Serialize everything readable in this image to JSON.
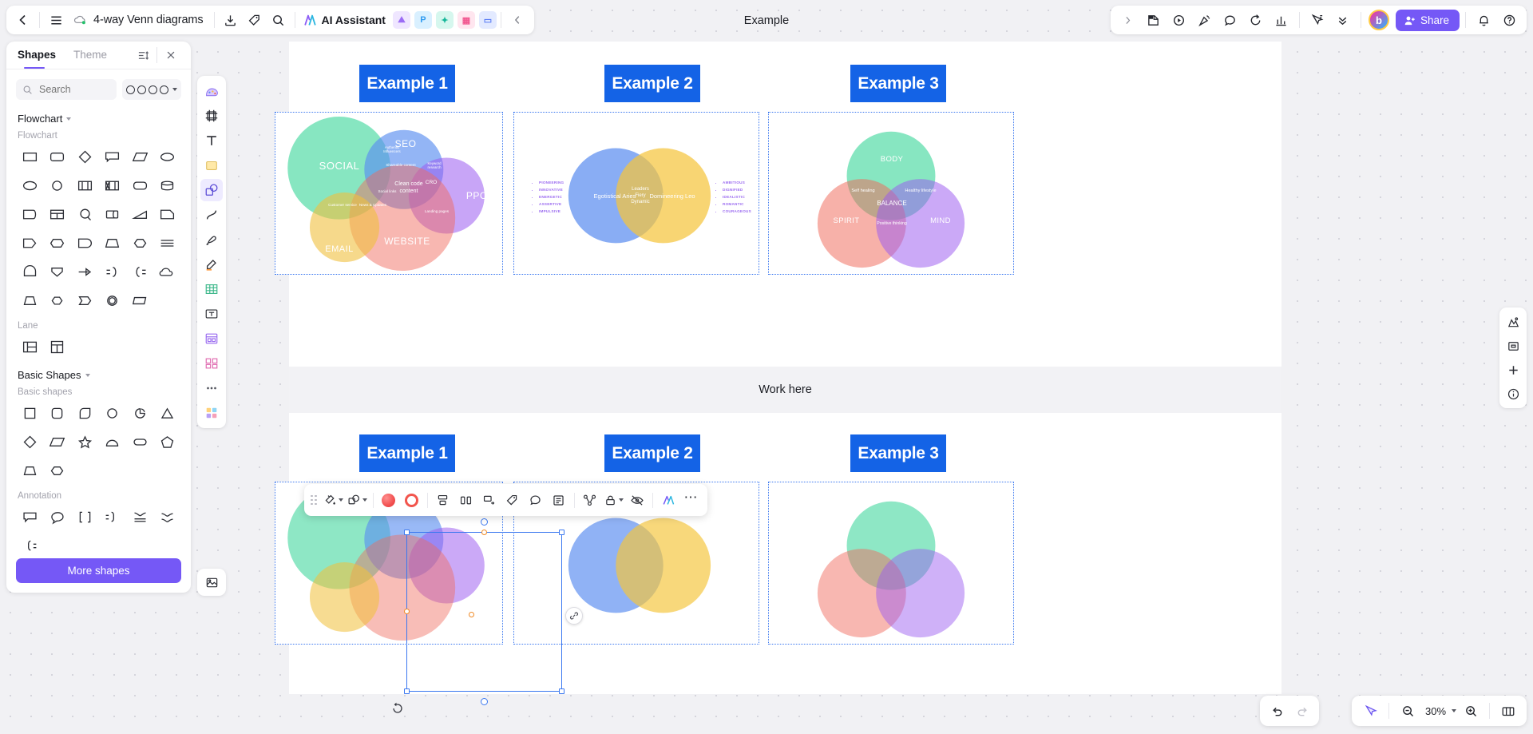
{
  "header": {
    "back_icon": "chevron-left-icon",
    "menu_icon": "hamburger-menu-icon",
    "cloud_icon": "cloud-sync-icon",
    "doc_title": "4-way Venn diagrams",
    "download_icon": "download-icon",
    "tag_icon": "tag-icon",
    "search_icon": "search-icon",
    "ai_assistant_label": "AI Assistant",
    "ai_icon": "ai-sparkle-icon",
    "apps": [
      {
        "name": "image-gen-app",
        "glyph": "⛰",
        "bg": "#efe6ff",
        "fg": "#9b6bf5"
      },
      {
        "name": "presentation-app",
        "glyph": "P",
        "bg": "#d9f0ff",
        "fg": "#2f9bf0"
      },
      {
        "name": "mindmap-app",
        "glyph": "✦",
        "bg": "#d6f7ee",
        "fg": "#16b79a"
      },
      {
        "name": "table-app",
        "glyph": "▦",
        "bg": "#ffe6ef",
        "fg": "#f2568f"
      },
      {
        "name": "comment-app",
        "glyph": "▭",
        "bg": "#e3eaff",
        "fg": "#5b7df5"
      }
    ],
    "collapse_icon": "chevron-left-icon",
    "center_title": "Example",
    "right_tools": [
      {
        "name": "expand-right-icon",
        "glyph": "chevron-right"
      },
      {
        "name": "sticky-note-icon",
        "glyph": "note"
      },
      {
        "name": "play-record-icon",
        "glyph": "play"
      },
      {
        "name": "celebrate-icon",
        "glyph": "party"
      },
      {
        "name": "comment-bubble-icon",
        "glyph": "bubble"
      },
      {
        "name": "timer-icon",
        "glyph": "timer"
      },
      {
        "name": "vote-chart-icon",
        "glyph": "chart"
      },
      {
        "name": "presenter-cursor-icon",
        "glyph": "cursor"
      },
      {
        "name": "chevron-double-down-icon",
        "glyph": "chevrons"
      }
    ],
    "avatar_initial": "b",
    "share_label": "Share",
    "share_color": "#7558f6",
    "share_icon": "person-add-icon",
    "bell_icon": "bell-icon",
    "help_icon": "question-circle-icon"
  },
  "shapes_panel": {
    "tabs": [
      {
        "label": "Shapes",
        "active": true
      },
      {
        "label": "Theme",
        "active": false
      }
    ],
    "list_icon": "sort-list-icon",
    "close_icon": "close-icon",
    "search_placeholder": "Search",
    "search_value": "",
    "shape_picker_icon": "circles-style-picker",
    "groups": [
      {
        "title": "Flowchart",
        "subsections": [
          {
            "label": "Flowchart",
            "shapes": [
              "rectangle",
              "rounded-rectangle",
              "diamond",
              "callout-rect",
              "parallelogram",
              "oval",
              "ellipse",
              "circle",
              "vertical-bars-box",
              "hatched-bars-box",
              "stadium",
              "cylinder",
              "flag-left",
              "split-table",
              "circle-q",
              "barrel",
              "trapezoid-right",
              "note-corner",
              "flag-right",
              "hexagon-flat",
              "rounded-tab",
              "trapezoid-flat",
              "hexagon",
              "divider-lines",
              "arch",
              "shield",
              "arrow-right",
              "bracket-right",
              "bracket-left",
              "cloud-shape",
              "trapezoid",
              "hexagon-2",
              "arrow-pentagon",
              "double-circle",
              "skew-rect"
            ]
          },
          {
            "label": "Lane",
            "shapes": [
              "lane-horizontal",
              "lane-vertical"
            ]
          }
        ]
      },
      {
        "title": "Basic Shapes",
        "subsections": [
          {
            "label": "Basic shapes",
            "shapes": [
              "square",
              "rounded-square",
              "leaf-square",
              "circle",
              "pie-slice",
              "triangle",
              "diamond",
              "parallelogram",
              "star",
              "semicircle",
              "pill",
              "pentagon",
              "trapezoid",
              "hexagon"
            ]
          },
          {
            "label": "Annotation",
            "shapes": [
              "speech-rect",
              "speech-round",
              "brackets",
              "brace-left-eq",
              "brace-horizontal",
              "brace-horizontal-2",
              "brace-right-eq"
            ]
          }
        ]
      }
    ],
    "more_shapes_label": "More shapes"
  },
  "tool_rail": [
    {
      "name": "tool-select-theme",
      "glyph": "palette"
    },
    {
      "name": "tool-frame",
      "glyph": "frame"
    },
    {
      "name": "tool-text",
      "glyph": "T"
    },
    {
      "name": "tool-sticky-note",
      "glyph": "sticky"
    },
    {
      "name": "tool-shapes",
      "glyph": "shapes",
      "selected": true
    },
    {
      "name": "tool-connector",
      "glyph": "curve"
    },
    {
      "name": "tool-pen",
      "glyph": "pen"
    },
    {
      "name": "tool-highlighter",
      "glyph": "marker"
    },
    {
      "name": "tool-table",
      "glyph": "table"
    },
    {
      "name": "tool-text-box",
      "glyph": "textbox"
    },
    {
      "name": "tool-container",
      "glyph": "container"
    },
    {
      "name": "tool-layout",
      "glyph": "layout"
    },
    {
      "name": "tool-more",
      "glyph": "dots"
    },
    {
      "name": "tool-library",
      "glyph": "library"
    }
  ],
  "tool_rail_bottom": {
    "name": "tool-image-upload",
    "glyph": "image"
  },
  "right_rail": [
    {
      "name": "minimap-toggle-icon",
      "glyph": "minimap"
    },
    {
      "name": "fit-screen-icon",
      "glyph": "fit"
    },
    {
      "name": "zoom-in-icon",
      "glyph": "plus"
    },
    {
      "name": "info-icon",
      "glyph": "info"
    }
  ],
  "board": {
    "work_here_label": "Work here",
    "top_examples": [
      {
        "title": "Example 1",
        "name": "example-1-top"
      },
      {
        "title": "Example 2",
        "name": "example-2-top"
      },
      {
        "title": "Example 3",
        "name": "example-3-top"
      }
    ],
    "bottom_examples": [
      {
        "title": "Example 1",
        "name": "example-1-bottom"
      },
      {
        "title": "Example 2",
        "name": "example-2-bottom"
      },
      {
        "title": "Example 3",
        "name": "example-3-bottom"
      }
    ]
  },
  "chart_data": [
    {
      "type": "venn",
      "id": "venn-4-way-marketing",
      "title": "Example 1",
      "sets": [
        {
          "label": "SOCIAL",
          "color": "#7fe0b8"
        },
        {
          "label": "SEO",
          "color": "#7fa8f0"
        },
        {
          "label": "PPC",
          "color": "#b48cf0"
        },
        {
          "label": "WEBSITE",
          "color": "#f5a79b"
        },
        {
          "label": "EMAIL",
          "color": "#f7d785"
        }
      ],
      "intersections": [
        "Authentic Influencers",
        "Shareable content",
        "Social links",
        "News & Updates",
        "Customer service",
        "Clean code content",
        "Keyword research",
        "CRO",
        "Landing pages"
      ]
    },
    {
      "type": "venn",
      "id": "venn-2-way-zodiac",
      "title": "Example 2",
      "sets": [
        {
          "label": "Egotistical Aries",
          "color": "#7fa8f0"
        },
        {
          "label": "Domineering Leo",
          "color": "#f7d36e"
        }
      ],
      "intersections": [
        "Leaders\nFiery\nDynamic"
      ],
      "left_list": [
        "PIONEERING",
        "INNOVATIVE",
        "ENERGETIC",
        "ASSERTIVE",
        "IMPULSIVE"
      ],
      "right_list": [
        "AMBITIOUS",
        "DIGNIFIED",
        "IDEALISTIC",
        "ROMANTIC",
        "COURAGEOUS"
      ],
      "list_color": "#9b6bf0"
    },
    {
      "type": "venn",
      "id": "venn-3-way-wellness",
      "title": "Example 3",
      "sets": [
        {
          "label": "BODY",
          "color": "#8fe3bd"
        },
        {
          "label": "SPIRIT",
          "color": "#f7a79b"
        },
        {
          "label": "MIND",
          "color": "#b68cf0"
        }
      ],
      "intersections": [
        "Self healing",
        "Healthy lifestyle",
        "Positive thinking",
        "BALANCE"
      ]
    }
  ],
  "float_toolbar": {
    "drag_handle": "drag-dots-handle",
    "items": [
      {
        "name": "fill-style-button",
        "glyph": "paint",
        "caret": true
      },
      {
        "name": "shape-style-button",
        "glyph": "shapes",
        "caret": true
      },
      {
        "name": "fill-color-swatch",
        "glyph": "swatch-red"
      },
      {
        "name": "border-color-swatch",
        "glyph": "swatch-ring"
      },
      {
        "name": "align-button",
        "glyph": "align"
      },
      {
        "name": "distribute-button",
        "glyph": "distribute"
      },
      {
        "name": "connector-style-button",
        "glyph": "connector"
      },
      {
        "name": "tag-button",
        "glyph": "tag"
      },
      {
        "name": "comment-button",
        "glyph": "comment"
      },
      {
        "name": "note-button",
        "glyph": "note"
      },
      {
        "name": "group-button",
        "glyph": "group"
      },
      {
        "name": "lock-button",
        "glyph": "lock",
        "caret": true
      },
      {
        "name": "hide-button",
        "glyph": "eye-off"
      },
      {
        "name": "ai-button",
        "glyph": "ai"
      },
      {
        "name": "more-options-button",
        "glyph": "dots"
      }
    ]
  },
  "selection": {
    "link_badge_icon": "link-shape-icon",
    "rotate_icon": "rotate-handle-icon"
  },
  "bottom_bar": {
    "undo_icon": "undo-icon",
    "redo_icon": "redo-icon",
    "cursor_icon": "cursor-select-icon",
    "zoom_out_icon": "zoom-out-icon",
    "zoom_value": "30%",
    "zoom_in_icon": "zoom-in-icon",
    "pages_icon": "pages-panel-icon"
  }
}
